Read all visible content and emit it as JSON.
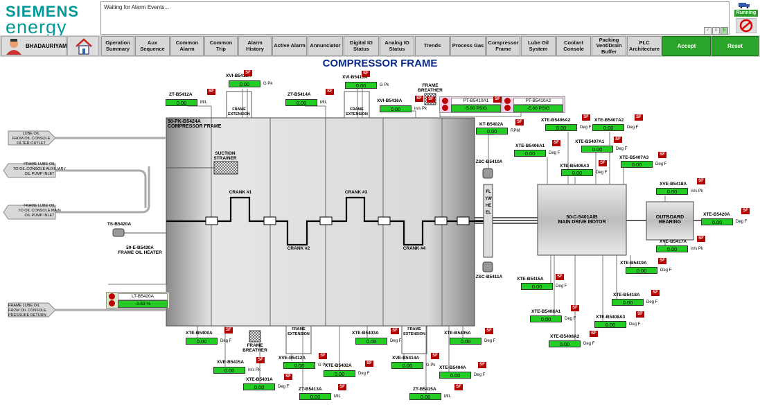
{
  "header": {
    "brand_line1": "SIEMENS",
    "brand_line2": "energy",
    "alarm_message": "Waiting for Alarm Events...",
    "status": "Running"
  },
  "nav": {
    "user": "BHADAURIYAMHI",
    "buttons": [
      "Operation Summary",
      "Aux Sequence",
      "Common Alarm",
      "Common Trip",
      "Alarm History",
      "Active Alarm",
      "Annunciator",
      "Digital IO Status",
      "Analog IO Status",
      "Trends",
      "Process Gas",
      "Compressor Frame",
      "Lube Oil System",
      "Coolant Console",
      "Packing Vent/Drain Buffer",
      "PLC Architecture"
    ],
    "accept": "Accept",
    "reset": "Reset"
  },
  "page_title": "COMPRESSOR FRAME",
  "sf": "SF",
  "labels": {
    "compressor_frame": "50-PK-B5424A\nCOMPRESSOR FRAME",
    "suction_strainer": "SUCTION\nSTRAINER",
    "crank1": "CRANK #1",
    "crank2": "CRANK #2",
    "crank3": "CRANK #3",
    "crank4": "CRANK #4",
    "frame_ext": "FRAME\nEXTENSION",
    "frame_breather": "FRAME\nBREATHER",
    "lube_oil_1": "LUBE OIL\nFROM OIL CONSOLE\nFILTER OUTLET",
    "lube_oil_2": "FRAME LUBE OIL\nTO OIL CONSOLE AUXILIARY\nOIL PUMP INLET",
    "lube_oil_3": "FRAME LUBE OIL\nTO OIL CONSOLE MAIN\nOIL PUMP INLET",
    "lube_oil_4": "FRAME LUBE OIL\nFROM OIL CONSOLE\nPRESSURE RETURN",
    "ts": "TS-B5420A",
    "heater": "50-E-B5430A\nFRAME OIL HEATER",
    "flywheel": "FLYWHEEL",
    "zsc1": "ZSC-B5410A",
    "zsc2": "ZSC-B5411A",
    "motor": "50-C-5401A/B\nMAIN DRIVE MOTOR",
    "bearing": "OUTBOARD\nBEARING"
  },
  "pt_a1": {
    "name": "PT-B5410A1",
    "value": "-5.80 PSIG"
  },
  "pt_a2": {
    "name": "PT-B5410A2",
    "value": "-5.80 PSIG"
  },
  "lt": {
    "name": "LT-B5420A",
    "value": "-3.63 %"
  },
  "instruments": [
    {
      "tag": "XVI-B5411A",
      "value": "0.00",
      "unit": "G Pk"
    },
    {
      "tag": "XVI-B5413A",
      "value": "0.00",
      "unit": "G Pk"
    },
    {
      "tag": "ZT-B5412A",
      "value": "0.00",
      "unit": "MIL"
    },
    {
      "tag": "ZT-B5414A",
      "value": "0.00",
      "unit": "MIL"
    },
    {
      "tag": "XVI-B5416A",
      "value": "0.00",
      "unit": "in/s Pk"
    },
    {
      "tag": "KT-B5402A",
      "value": "0.00",
      "unit": "RPM"
    },
    {
      "tag": "XTE-B5406A2",
      "value": "0.00",
      "unit": "Deg F"
    },
    {
      "tag": "XTE-B5407A2",
      "value": "0.00",
      "unit": "Deg F"
    },
    {
      "tag": "XTE-B5406A1",
      "value": "0.00",
      "unit": "Deg F"
    },
    {
      "tag": "XTE-B5407A1",
      "value": "0.00",
      "unit": "Deg F"
    },
    {
      "tag": "XTE-B5406A3",
      "value": "0.00",
      "unit": "Deg F"
    },
    {
      "tag": "XTE-B5407A3",
      "value": "0.00",
      "unit": "Deg F"
    },
    {
      "tag": "XVE-B5418A",
      "value": "0.00",
      "unit": "in/s Pk"
    },
    {
      "tag": "XTE-B5420A",
      "value": "0.00",
      "unit": "Deg F"
    },
    {
      "tag": "XVE-B5417A",
      "value": "0.00",
      "unit": "in/s Pk"
    },
    {
      "tag": "XTE-B5419A",
      "value": "0.00",
      "unit": "Deg F"
    },
    {
      "tag": "XTE-B5415A",
      "value": "0.00",
      "unit": "Deg F"
    },
    {
      "tag": "XTE-B5418A",
      "value": "0.00",
      "unit": "Deg F"
    },
    {
      "tag": "XTE-B5408A1",
      "value": "0.00",
      "unit": "Deg F"
    },
    {
      "tag": "XTE-B5408A3",
      "value": "0.00",
      "unit": "Deg F"
    },
    {
      "tag": "XTE-B5408A2",
      "value": "0.00",
      "unit": "Deg F"
    },
    {
      "tag": "XTE-B5400A",
      "value": "0.00",
      "unit": "Deg F"
    },
    {
      "tag": "XVE-B5415A",
      "value": "0.00",
      "unit": "in/s Pk"
    },
    {
      "tag": "XTE-B5401A",
      "value": "0.00",
      "unit": "Deg F"
    },
    {
      "tag": "XVE-B5412A",
      "value": "0.00",
      "unit": "G Pk"
    },
    {
      "tag": "ZT-B5413A",
      "value": "0.00",
      "unit": "MIL"
    },
    {
      "tag": "XTE-B5402A",
      "value": "0.00",
      "unit": "Deg F"
    },
    {
      "tag": "XTE-B5403A",
      "value": "0.00",
      "unit": "Deg F"
    },
    {
      "tag": "XVE-B5414A",
      "value": "0.00",
      "unit": "G Pk"
    },
    {
      "tag": "ZT-B5415A",
      "value": "0.00",
      "unit": "MIL"
    },
    {
      "tag": "XTE-B5404A",
      "value": "0.00",
      "unit": "Deg F"
    },
    {
      "tag": "XTE-B5405A",
      "value": "0.00",
      "unit": "Deg F"
    }
  ]
}
